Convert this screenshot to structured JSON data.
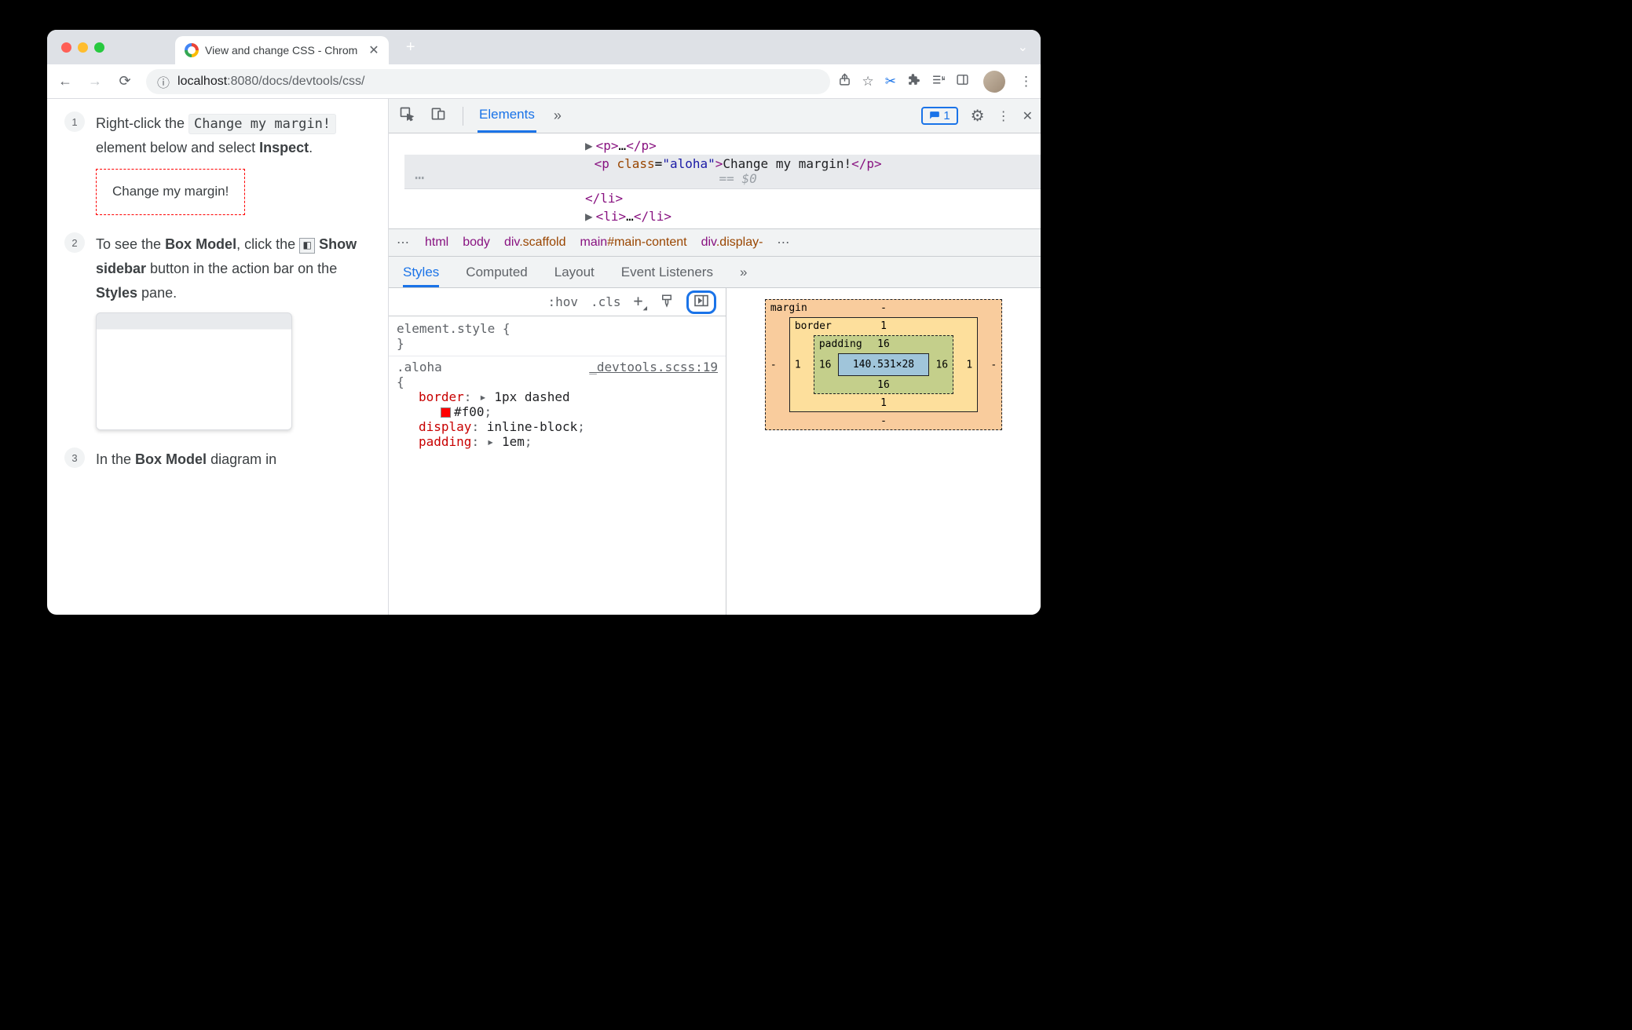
{
  "browser": {
    "tab_title": "View and change CSS - Chrom",
    "url_host": "localhost",
    "url_port": ":8080",
    "url_path": "/docs/devtools/css/"
  },
  "page": {
    "steps": [
      {
        "num": "1",
        "pre": "Right-click the ",
        "code": "Change my margin!",
        "mid": " element below and select ",
        "bold": "Inspect",
        "post": "."
      },
      {
        "num": "2",
        "pre": "To see the ",
        "bold1": "Box Model",
        "mid1": ", click the ",
        "bold2": "Show sidebar",
        "mid2": " button in the action bar on the ",
        "bold3": "Styles",
        "post": " pane."
      },
      {
        "num": "3",
        "pre": "In the ",
        "bold": "Box Model",
        "post": " diagram in"
      }
    ],
    "dashed_box": "Change my margin!"
  },
  "devtools": {
    "main_tab": "Elements",
    "issues_count": "1",
    "dom": {
      "row0": {
        "open": "<p>",
        "ell": "…",
        "close": "</p>"
      },
      "row1_html": "<p class=\"aloha\">Change my margin!</p>",
      "row1_eq": "== $0",
      "row2": "</li>",
      "row3": {
        "open": "<li>",
        "ell": "…",
        "close": "</li>"
      }
    },
    "crumbs": [
      "html",
      "body",
      "div.scaffold",
      "main#main-content",
      "div.display-"
    ],
    "sub_tabs": [
      "Styles",
      "Computed",
      "Layout",
      "Event Listeners"
    ],
    "tools": {
      "hov": ":hov",
      "cls": ".cls"
    },
    "css": {
      "elstyle": "element.style {",
      "elstyle_close": "}",
      "rule_sel": ".aloha",
      "rule_src": "_devtools.scss:19",
      "brace": "{",
      "border_prop": "border",
      "border_val": "1px dashed",
      "border_color": "#f00",
      "display_prop": "display",
      "display_val": "inline-block",
      "padding_prop": "padding",
      "padding_val": "1em"
    },
    "boxmodel": {
      "margin_label": "margin",
      "border_label": "border",
      "padding_label": "padding",
      "margin": {
        "t": "-",
        "r": "-",
        "b": "-",
        "l": "-"
      },
      "border": {
        "t": "1",
        "r": "1",
        "b": "1",
        "l": "1"
      },
      "padding": {
        "t": "16",
        "r": "16",
        "b": "16",
        "l": "16"
      },
      "content": "140.531×28"
    }
  }
}
